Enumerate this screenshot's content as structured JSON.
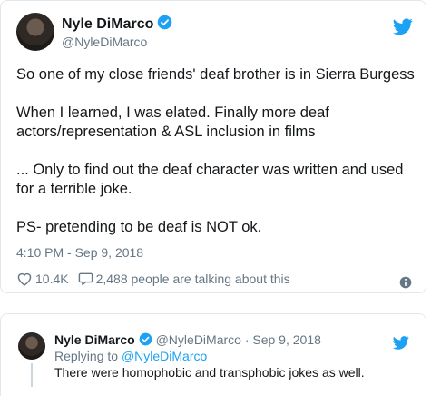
{
  "tweet": {
    "name": "Nyle DiMarco",
    "handle": "@NyleDiMarco",
    "paragraphs": [
      "So one of my close friends' deaf brother is in Sierra Burgess",
      "When I learned, I was elated. Finally more deaf actors/representation & ASL inclusion in films",
      "... Only to find out the deaf character was written and used for a terrible joke.",
      "PS- pretending to be deaf is NOT ok."
    ],
    "timestamp": "4:10 PM - Sep 9, 2018",
    "likes": "10.4K",
    "talking": "2,488 people are talking about this"
  },
  "reply": {
    "name": "Nyle DiMarco",
    "handle": "@NyleDiMarco",
    "date": "· Sep 9, 2018",
    "replying_prefix": "Replying to",
    "replying_to": "@NyleDiMarco",
    "text": "There were homophobic and transphobic jokes as well."
  },
  "colors": {
    "accent": "#1da1f2",
    "muted": "#657786",
    "text": "#14171a",
    "like_icon": "#657786"
  },
  "icons": [
    "verified-badge-icon",
    "twitter-bird-icon",
    "heart-icon",
    "comment-bubble-icon",
    "info-icon"
  ]
}
